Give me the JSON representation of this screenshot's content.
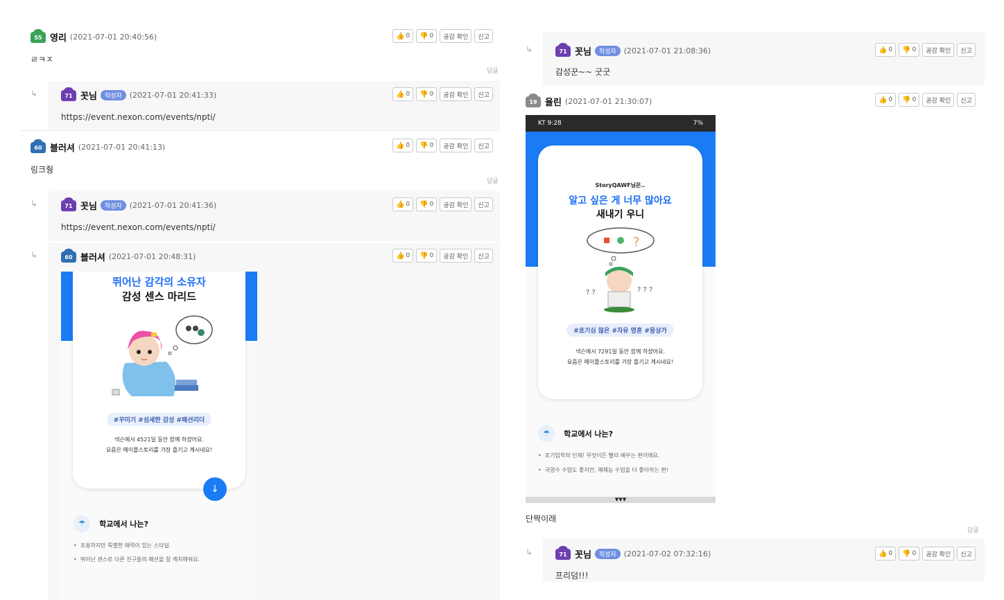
{
  "buttons": {
    "like_count": "0",
    "dislike_count": "0",
    "empathy_label": "공감 확인",
    "report_label": "신고"
  },
  "reply_label": "답글",
  "reply_arrow": "↳",
  "author_badge": "작성자",
  "left": {
    "c1": {
      "level": "55",
      "author": "영리",
      "date": "(2021-07-01 20:40:56)",
      "text": "ㄹㅋㅈ"
    },
    "c2": {
      "level": "71",
      "author": "꼿님",
      "date": "(2021-07-01 20:41:33)",
      "text": "https://event.nexon.com/events/npti/"
    },
    "c3": {
      "level": "60",
      "author": "블러셔",
      "date": "(2021-07-01 20:41:13)",
      "text": "링크줭"
    },
    "c4": {
      "level": "71",
      "author": "꼿님",
      "date": "(2021-07-01 20:41:36)",
      "text": "https://event.nexon.com/events/npti/"
    },
    "c5": {
      "level": "60",
      "author": "블러셔",
      "date": "(2021-07-01 20:48:31)"
    },
    "img": {
      "title1": "뛰어난 감각의 소유자",
      "title2": "감성 센스 마리드",
      "tags": "#꾸미기 #섬세한 감성 #패션리더",
      "desc1": "넥슨에서 4521일 동안 함께 하셨어요.",
      "desc2": "요즘은 메이플스토리를 가장 즐기고 계시네요!",
      "section": "학교에서 나는?",
      "bullet1": "조용하지만 특별한 매력이 있는 스타일.",
      "bullet2": "뛰어난 센스로 다른 친구들의 패션을 잘 캐치해줘요."
    }
  },
  "right": {
    "c1": {
      "level": "71",
      "author": "꼿님",
      "date": "(2021-07-01 21:08:36)",
      "text": "감성꾼~~ 굿굿"
    },
    "c2": {
      "level": "19",
      "author": "율린",
      "date": "(2021-07-01 21:30:07)",
      "text": "단짝이래"
    },
    "c3": {
      "level": "71",
      "author": "꼿님",
      "date": "(2021-07-02 07:32:16)",
      "text": "프리덤!!!"
    },
    "img": {
      "status_left": "KT 9:28",
      "status_right": "7%",
      "subtitle": "StoryQAWF님은..",
      "title1": "알고 싶은 게 너무 많아요",
      "title2": "새내기 우니",
      "tags": "#호기심 많은 #자유 영혼 #몽상가",
      "desc1": "넥슨에서 7291일 동안 함께 하셨어요.",
      "desc2": "요즘은 메이플스토리를 가장 즐기고 계시네요!",
      "section": "학교에서 나는?",
      "bullet1": "조기입학의 인재! 무엇이든 빨리 배우는 편이에요.",
      "bullet2": "국영수 수업도 좋지만, 예체능 수업을 더 좋아하는 편!"
    }
  }
}
